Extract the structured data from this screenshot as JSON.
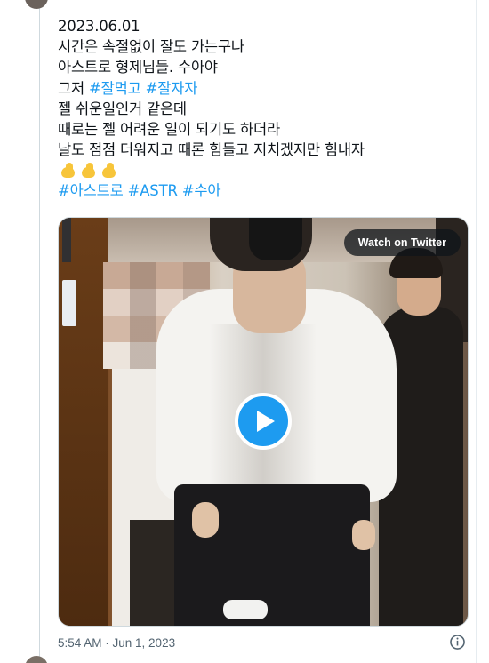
{
  "tweet": {
    "date_line": "2023.06.01",
    "line2": "시간은 속절없이 잘도 가는구나",
    "line3": "아스트로 형제님들. 수아야",
    "line4_prefix": "그저 ",
    "line4_tag1": "#잘먹고",
    "line4_tag2": "#잘자자",
    "line5": "젤 쉬운일인거 같은데",
    "line6": "때로는 젤 어려운 일이 되기도 하더라",
    "line7": "날도 점점 더워지고 때론 힘들고 지치겠지만 힘내자",
    "emoji": [
      "flexed-biceps",
      "flexed-biceps",
      "flexed-biceps"
    ],
    "hashtags": [
      "#아스트로",
      "#ASTR",
      "#수아"
    ]
  },
  "video": {
    "watch_label": "Watch on Twitter",
    "play_icon": "play-icon"
  },
  "meta": {
    "timestamp": "5:54 AM · Jun 1, 2023",
    "info_icon": "info-icon"
  },
  "colors": {
    "text": "#0f1419",
    "link": "#1d9bf0",
    "muted": "#536471",
    "border": "#cfd9de"
  }
}
